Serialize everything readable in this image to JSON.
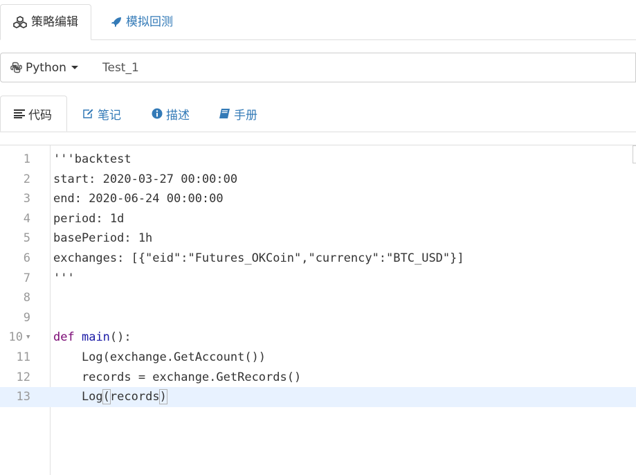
{
  "top_tabs": {
    "active": {
      "label": "策略编辑",
      "icon": "cubes-icon"
    },
    "inactive": {
      "label": "模拟回测",
      "icon": "rocket-icon"
    }
  },
  "language": {
    "label": "Python",
    "icon": "python-icon"
  },
  "strategy_name": {
    "value": "Test_1"
  },
  "sub_tabs": [
    {
      "label": "代码",
      "icon": "list-icon"
    },
    {
      "label": "笔记",
      "icon": "edit-icon"
    },
    {
      "label": "描述",
      "icon": "info-icon"
    },
    {
      "label": "手册",
      "icon": "book-icon"
    }
  ],
  "editor": {
    "lines": [
      {
        "num": "1",
        "text": "'''backtest"
      },
      {
        "num": "2",
        "text": "start: 2020-03-27 00:00:00"
      },
      {
        "num": "3",
        "text": "end: 2020-06-24 00:00:00"
      },
      {
        "num": "4",
        "text": "period: 1d"
      },
      {
        "num": "5",
        "text": "basePeriod: 1h"
      },
      {
        "num": "6",
        "text": "exchanges: [{\"eid\":\"Futures_OKCoin\",\"currency\":\"BTC_USD\"}]"
      },
      {
        "num": "7",
        "text": "'''"
      },
      {
        "num": "8",
        "text": ""
      },
      {
        "num": "9",
        "text": ""
      },
      {
        "num": "10",
        "kw": "def",
        "fn": "main",
        "rest": "():"
      },
      {
        "num": "11",
        "text": "    Log(exchange.GetAccount())"
      },
      {
        "num": "12",
        "text": "    records = exchange.GetRecords()"
      },
      {
        "num": "13",
        "pre": "    Log",
        "open": "(",
        "arg": "records",
        "close": ")"
      }
    ],
    "current_line": 13
  },
  "colors": {
    "link": "#337ab7",
    "string": "#1a1aa6",
    "keyword": "#7a0874",
    "active_line": "#e8f2ff"
  }
}
